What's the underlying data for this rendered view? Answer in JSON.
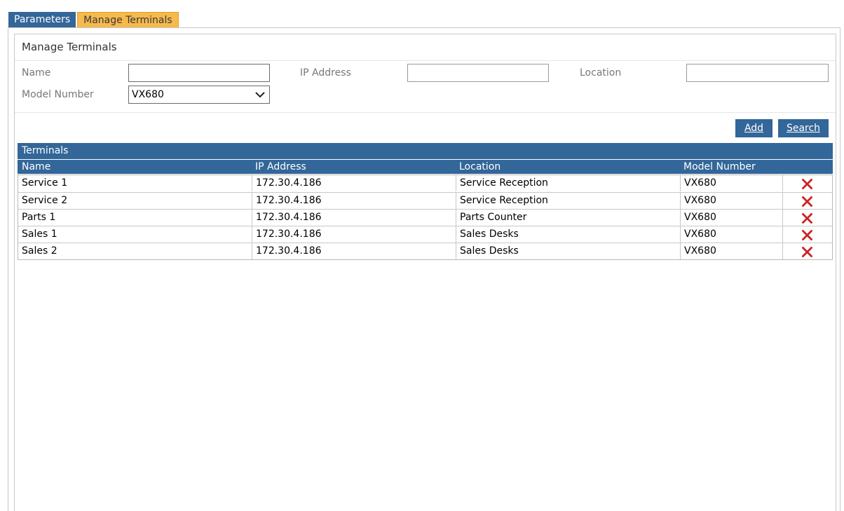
{
  "tabs": [
    {
      "label": "Parameters",
      "active": false
    },
    {
      "label": "Manage Terminals",
      "active": true
    }
  ],
  "panel_title": "Manage Terminals",
  "filters": {
    "name_label": "Name",
    "name_value": "",
    "ip_label": "IP Address",
    "ip_value": "",
    "location_label": "Location",
    "location_value": "",
    "model_label": "Model Number",
    "model_value": "VX680"
  },
  "actions": {
    "add_label": "Add",
    "search_label": "Search"
  },
  "grid": {
    "title": "Terminals",
    "columns": [
      "Name",
      "IP Address",
      "Location",
      "Model Number"
    ],
    "rows": [
      {
        "name": "Service 1",
        "ip": "172.30.4.186",
        "location": "Service Reception",
        "model": "VX680"
      },
      {
        "name": "Service 2",
        "ip": "172.30.4.186",
        "location": "Service Reception",
        "model": "VX680"
      },
      {
        "name": "Parts 1",
        "ip": "172.30.4.186",
        "location": "Parts Counter",
        "model": "VX680"
      },
      {
        "name": "Sales 1",
        "ip": "172.30.4.186",
        "location": "Sales Desks",
        "model": "VX680"
      },
      {
        "name": "Sales 2",
        "ip": "172.30.4.186",
        "location": "Sales Desks",
        "model": "VX680"
      }
    ]
  },
  "icons": {
    "delete": "close-x-icon",
    "dropdown": "chevron-down-icon"
  },
  "colors": {
    "primary": "#336699",
    "active_tab": "#f6b94c",
    "delete": "#cc2222"
  }
}
